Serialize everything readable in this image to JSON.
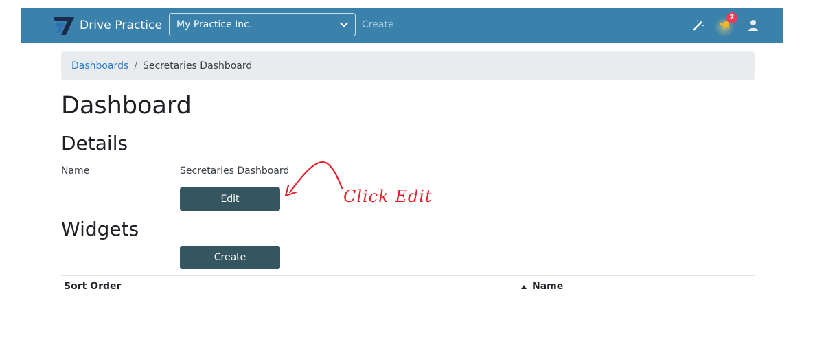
{
  "navbar": {
    "brand_name": "Drive Practice",
    "practice_select": {
      "value": "My Practice Inc."
    },
    "create_link": "Create",
    "notifications_count": "2",
    "accent_color": "#3a82ac"
  },
  "breadcrumb": {
    "items": [
      {
        "label": "Dashboards",
        "link": true
      },
      {
        "label": "Secretaries Dashboard",
        "link": false
      }
    ],
    "separator": "/"
  },
  "page": {
    "title": "Dashboard",
    "details": {
      "heading": "Details",
      "name_label": "Name",
      "name_value": "Secretaries Dashboard",
      "edit_button": "Edit"
    },
    "widgets": {
      "heading": "Widgets",
      "create_button": "Create",
      "table": {
        "columns": [
          "Sort Order",
          "Name"
        ],
        "sorted_column": "Name",
        "sort_direction": "ascending",
        "rows": []
      }
    }
  },
  "annotation": {
    "text": "Click Edit",
    "color": "#e3222c"
  },
  "icons": {
    "logo": "drive-practice-logo-icon",
    "chevron": "chevron-down-icon",
    "magic": "magic-wand-icon",
    "megaphone": "megaphone-icon",
    "user": "user-icon",
    "sort": "sort-caret-up-icon"
  }
}
